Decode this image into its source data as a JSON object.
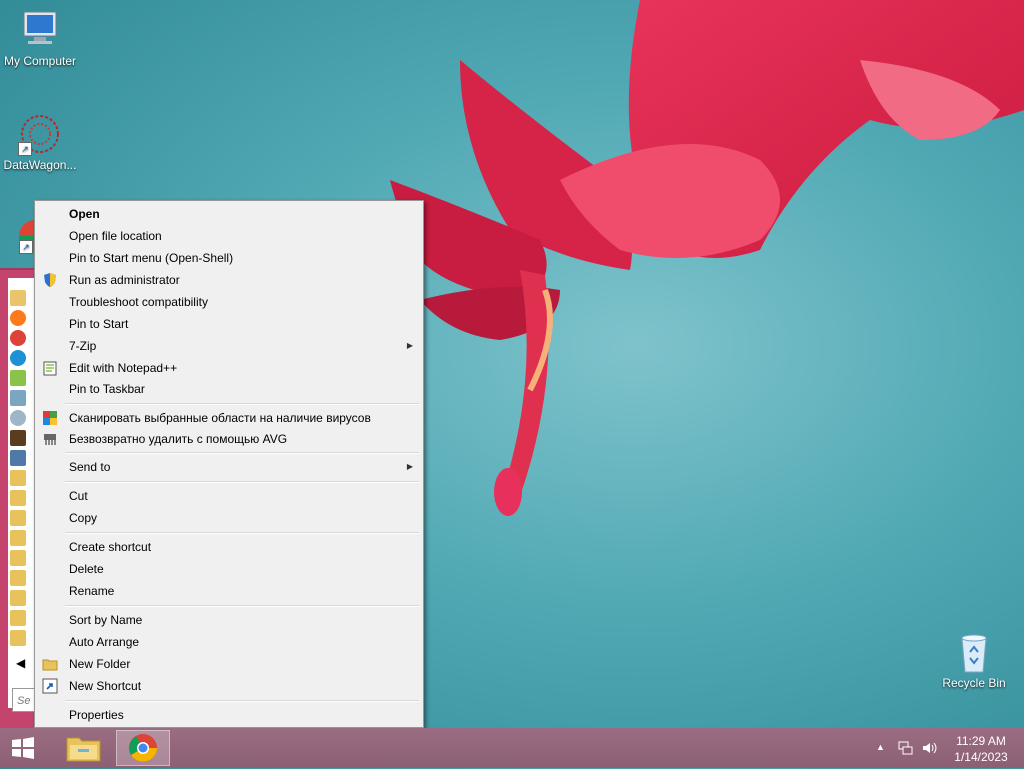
{
  "desktop": {
    "icons": [
      {
        "label": "My Computer"
      },
      {
        "label": "DataWagon..."
      },
      {
        "label": "Recycle Bin"
      }
    ]
  },
  "start_menu": {
    "search_placeholder": "Se"
  },
  "context_menu": {
    "items": [
      {
        "label": "Open"
      },
      {
        "label": "Open file location"
      },
      {
        "label": "Pin to Start menu (Open-Shell)"
      },
      {
        "label": "Run as administrator",
        "icon": "shield-icon"
      },
      {
        "label": "Troubleshoot compatibility"
      },
      {
        "label": "Pin to Start"
      },
      {
        "label": "7-Zip",
        "submenu": true
      },
      {
        "label": "Edit with Notepad++",
        "icon": "notepadpp-icon"
      },
      {
        "label": "Pin to Taskbar"
      },
      {
        "label": "Сканировать выбранные области на наличие вирусов",
        "icon": "avg-icon"
      },
      {
        "label": "Безвозвратно удалить с помощью AVG",
        "icon": "shredder-icon"
      },
      {
        "label": "Send to",
        "submenu": true
      },
      {
        "label": "Cut"
      },
      {
        "label": "Copy"
      },
      {
        "label": "Create shortcut"
      },
      {
        "label": "Delete"
      },
      {
        "label": "Rename"
      },
      {
        "label": "Sort by Name"
      },
      {
        "label": "Auto Arrange"
      },
      {
        "label": "New Folder",
        "icon": "folder-icon"
      },
      {
        "label": "New Shortcut",
        "icon": "shortcut-icon"
      },
      {
        "label": "Properties"
      }
    ],
    "submenu_arrow": "▶"
  },
  "taskbar": {
    "tray_overflow": "▲",
    "clock": {
      "time": "11:29 AM",
      "date": "1/14/2023"
    }
  },
  "colors": {
    "start_menu_accent": "#c5446e",
    "taskbar": "#8c5f75",
    "menu_bg": "#f0f0f0"
  }
}
